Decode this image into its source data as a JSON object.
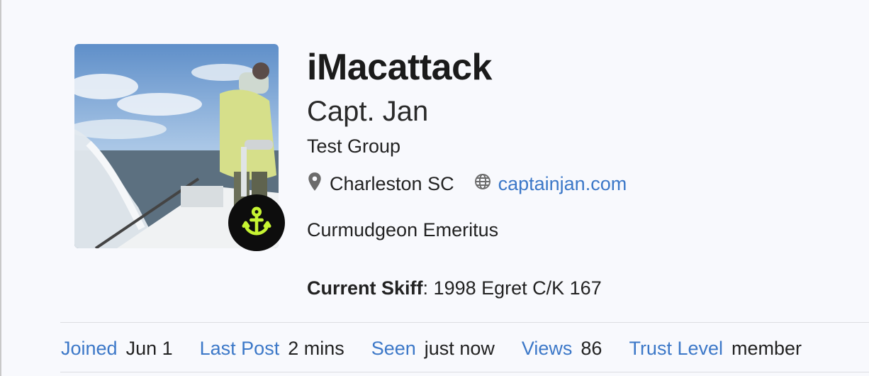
{
  "profile": {
    "username": "iMacattack",
    "full_name": "Capt. Jan",
    "group": "Test Group",
    "location": "Charleston SC",
    "website": "captainjan.com",
    "bio": "Curmudgeon Emeritus",
    "custom_field": {
      "label": "Current Skiff",
      "value": "1998 Egret C/K 167"
    },
    "flair_icon": "anchor-icon",
    "flair_color": "#c6f432"
  },
  "stats": [
    {
      "label": "Joined",
      "value": "Jun 1"
    },
    {
      "label": "Last Post",
      "value": "2 mins"
    },
    {
      "label": "Seen",
      "value": "just now"
    },
    {
      "label": "Views",
      "value": "86"
    },
    {
      "label": "Trust Level",
      "value": "member"
    }
  ],
  "colors": {
    "link": "#3c78c8",
    "text": "#222222",
    "background": "#f8f9fd"
  }
}
